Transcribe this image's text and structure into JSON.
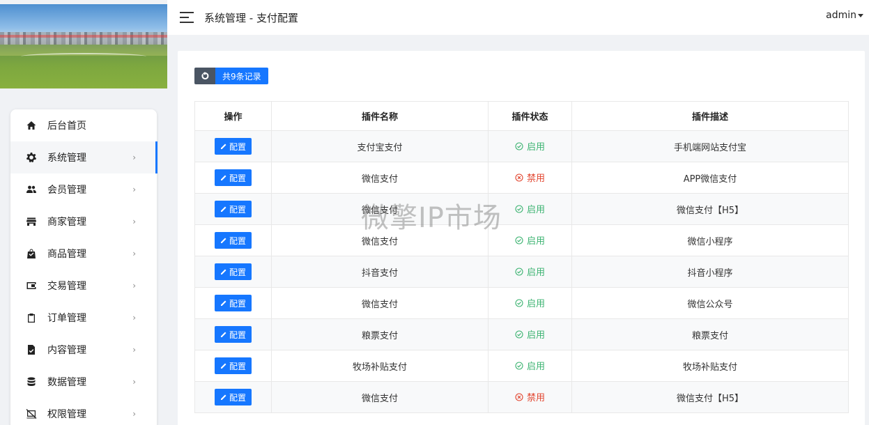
{
  "header": {
    "breadcrumb": "系统管理 - 支付配置",
    "user": "admin"
  },
  "sidebar": {
    "items": [
      {
        "label": "后台首页",
        "icon": "home-icon"
      },
      {
        "label": "系统管理",
        "icon": "gear-icon",
        "active": true
      },
      {
        "label": "会员管理",
        "icon": "people-icon"
      },
      {
        "label": "商家管理",
        "icon": "store-icon"
      },
      {
        "label": "商品管理",
        "icon": "shopping-bag-icon"
      },
      {
        "label": "交易管理",
        "icon": "wallet-icon"
      },
      {
        "label": "订单管理",
        "icon": "clipboard-icon"
      },
      {
        "label": "内容管理",
        "icon": "document-icon"
      },
      {
        "label": "数据管理",
        "icon": "database-icon"
      },
      {
        "label": "权限管理",
        "icon": "monitor-off-icon"
      }
    ],
    "arrow": "›"
  },
  "toolbar": {
    "record_count": "共9条记录"
  },
  "table": {
    "headers": [
      "操作",
      "插件名称",
      "插件状态",
      "插件描述"
    ],
    "action_label": "配置",
    "rows": [
      {
        "name": "支付宝支付",
        "status": "启用",
        "enabled": true,
        "desc": "手机端网站支付宝"
      },
      {
        "name": "微信支付",
        "status": "禁用",
        "enabled": false,
        "desc": "APP微信支付"
      },
      {
        "name": "微信支付",
        "status": "启用",
        "enabled": true,
        "desc": "微信支付【H5】"
      },
      {
        "name": "微信支付",
        "status": "启用",
        "enabled": true,
        "desc": "微信小程序"
      },
      {
        "name": "抖音支付",
        "status": "启用",
        "enabled": true,
        "desc": "抖音小程序"
      },
      {
        "name": "微信支付",
        "status": "启用",
        "enabled": true,
        "desc": "微信公众号"
      },
      {
        "name": "粮票支付",
        "status": "启用",
        "enabled": true,
        "desc": "粮票支付"
      },
      {
        "name": "牧场补贴支付",
        "status": "启用",
        "enabled": true,
        "desc": "牧场补贴支付"
      },
      {
        "name": "微信支付",
        "status": "禁用",
        "enabled": false,
        "desc": "微信支付【H5】"
      }
    ]
  },
  "watermark": "微擎IP市场",
  "colors": {
    "primary": "#1677ff",
    "enabled": "#3cb371",
    "disabled": "#e2452f"
  }
}
